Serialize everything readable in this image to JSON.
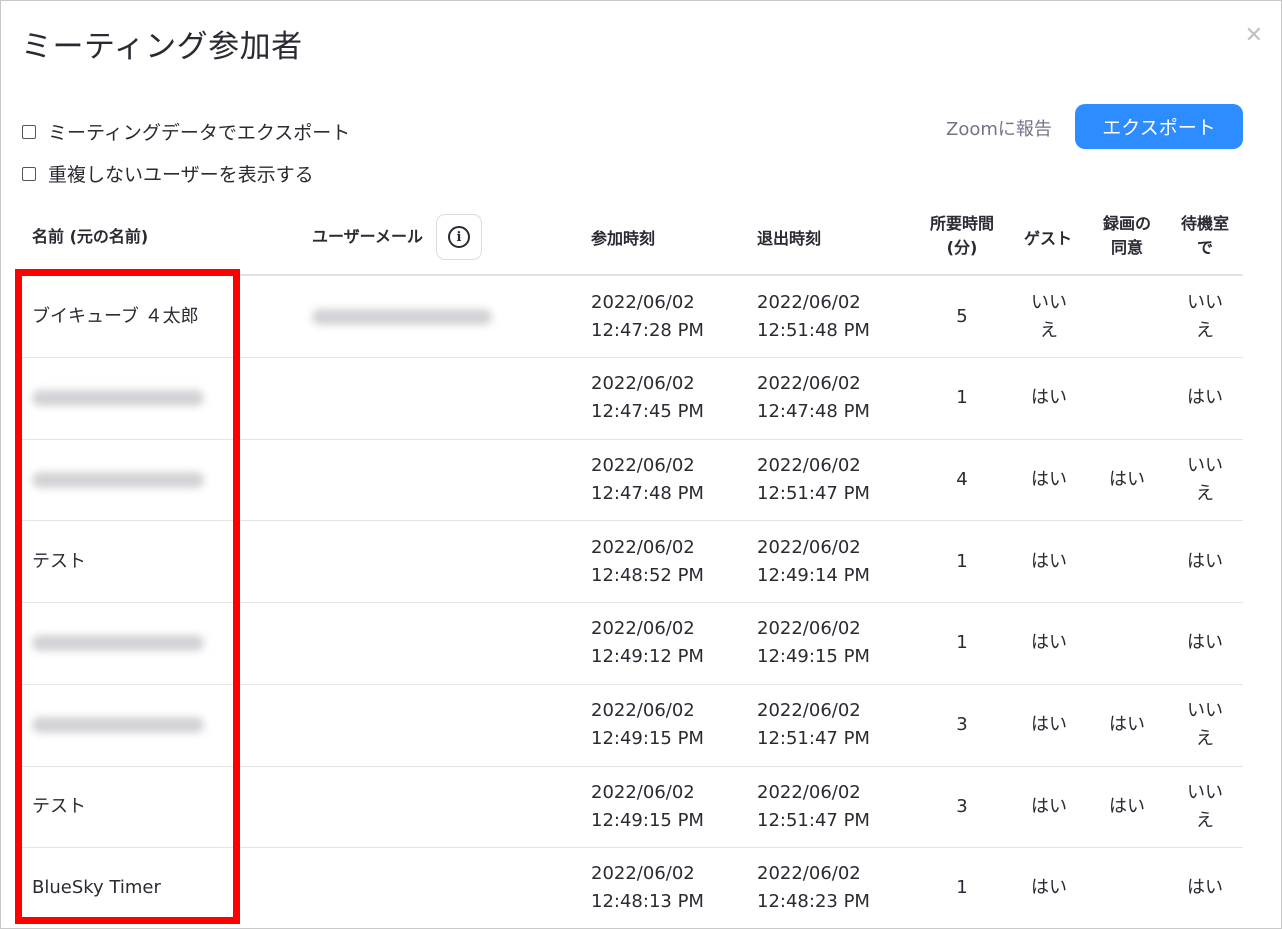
{
  "dialog": {
    "title": "ミーティング参加者",
    "close_icon": "close-icon"
  },
  "options": {
    "export_with_meeting_data": "ミーティングデータでエクスポート",
    "show_unique_users": "重複しないユーザーを表示する"
  },
  "toolbar": {
    "report_label": "Zoomに報告",
    "export_label": "エクスポート"
  },
  "table": {
    "headers": {
      "name": "名前 (元の名前)",
      "email": "ユーザーメール",
      "join_time": "参加時刻",
      "leave_time": "退出時刻",
      "duration_line1": "所要時間",
      "duration_line2": "(分)",
      "guest": "ゲスト",
      "recording_line1": "録画の",
      "recording_line2": "同意",
      "waiting_line1": "待機室",
      "waiting_line2": "で"
    },
    "rows": [
      {
        "name": "ブイキューブ ４太郎",
        "name_blurred": false,
        "email_blurred": true,
        "join_date": "2022/06/02",
        "join_time": "12:47:28 PM",
        "leave_date": "2022/06/02",
        "leave_time": "12:51:48 PM",
        "duration": "5",
        "guest_1": "いい",
        "guest_2": "え",
        "recording": "",
        "waiting_1": "いい",
        "waiting_2": "え"
      },
      {
        "name": "",
        "name_blurred": true,
        "email_blurred": false,
        "join_date": "2022/06/02",
        "join_time": "12:47:45 PM",
        "leave_date": "2022/06/02",
        "leave_time": "12:47:48 PM",
        "duration": "1",
        "guest_1": "はい",
        "guest_2": "",
        "recording": "",
        "waiting_1": "はい",
        "waiting_2": ""
      },
      {
        "name": "",
        "name_blurred": true,
        "email_blurred": false,
        "join_date": "2022/06/02",
        "join_time": "12:47:48 PM",
        "leave_date": "2022/06/02",
        "leave_time": "12:51:47 PM",
        "duration": "4",
        "guest_1": "はい",
        "guest_2": "",
        "recording": "はい",
        "waiting_1": "いい",
        "waiting_2": "え"
      },
      {
        "name": "テスト",
        "name_blurred": false,
        "email_blurred": false,
        "join_date": "2022/06/02",
        "join_time": "12:48:52 PM",
        "leave_date": "2022/06/02",
        "leave_time": "12:49:14 PM",
        "duration": "1",
        "guest_1": "はい",
        "guest_2": "",
        "recording": "",
        "waiting_1": "はい",
        "waiting_2": ""
      },
      {
        "name": "",
        "name_blurred": true,
        "email_blurred": false,
        "join_date": "2022/06/02",
        "join_time": "12:49:12 PM",
        "leave_date": "2022/06/02",
        "leave_time": "12:49:15 PM",
        "duration": "1",
        "guest_1": "はい",
        "guest_2": "",
        "recording": "",
        "waiting_1": "はい",
        "waiting_2": ""
      },
      {
        "name": "",
        "name_blurred": true,
        "email_blurred": false,
        "join_date": "2022/06/02",
        "join_time": "12:49:15 PM",
        "leave_date": "2022/06/02",
        "leave_time": "12:51:47 PM",
        "duration": "3",
        "guest_1": "はい",
        "guest_2": "",
        "recording": "はい",
        "waiting_1": "いい",
        "waiting_2": "え"
      },
      {
        "name": "テスト",
        "name_blurred": false,
        "email_blurred": false,
        "join_date": "2022/06/02",
        "join_time": "12:49:15 PM",
        "leave_date": "2022/06/02",
        "leave_time": "12:51:47 PM",
        "duration": "3",
        "guest_1": "はい",
        "guest_2": "",
        "recording": "はい",
        "waiting_1": "いい",
        "waiting_2": "え"
      },
      {
        "name": "BlueSky Timer",
        "name_blurred": false,
        "email_blurred": false,
        "join_date": "2022/06/02",
        "join_time": "12:48:13 PM",
        "leave_date": "2022/06/02",
        "leave_time": "12:48:23 PM",
        "duration": "1",
        "guest_1": "はい",
        "guest_2": "",
        "recording": "",
        "waiting_1": "はい",
        "waiting_2": ""
      }
    ]
  },
  "colors": {
    "accent": "#2d8cff",
    "highlight": "#ff0000"
  }
}
